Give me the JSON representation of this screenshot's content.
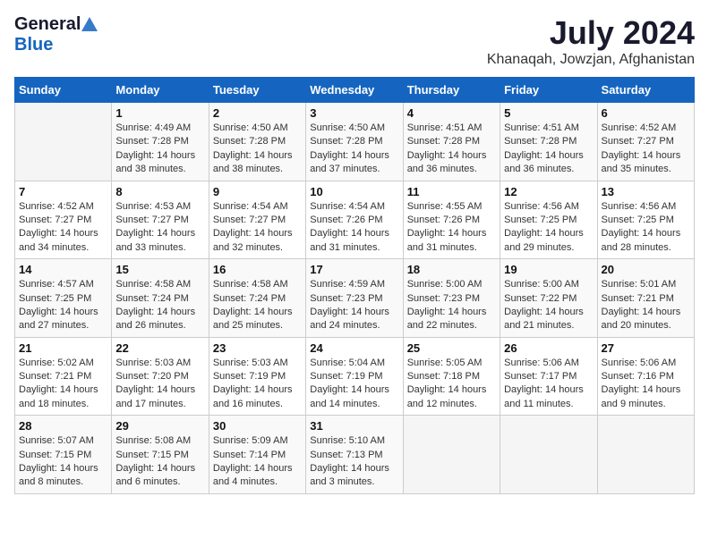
{
  "header": {
    "logo_general": "General",
    "logo_blue": "Blue",
    "title": "July 2024",
    "location": "Khanaqah, Jowzjan, Afghanistan"
  },
  "calendar": {
    "days_of_week": [
      "Sunday",
      "Monday",
      "Tuesday",
      "Wednesday",
      "Thursday",
      "Friday",
      "Saturday"
    ],
    "weeks": [
      [
        {
          "day": "",
          "sunrise": "",
          "sunset": "",
          "daylight": ""
        },
        {
          "day": "1",
          "sunrise": "Sunrise: 4:49 AM",
          "sunset": "Sunset: 7:28 PM",
          "daylight": "Daylight: 14 hours and 38 minutes."
        },
        {
          "day": "2",
          "sunrise": "Sunrise: 4:50 AM",
          "sunset": "Sunset: 7:28 PM",
          "daylight": "Daylight: 14 hours and 38 minutes."
        },
        {
          "day": "3",
          "sunrise": "Sunrise: 4:50 AM",
          "sunset": "Sunset: 7:28 PM",
          "daylight": "Daylight: 14 hours and 37 minutes."
        },
        {
          "day": "4",
          "sunrise": "Sunrise: 4:51 AM",
          "sunset": "Sunset: 7:28 PM",
          "daylight": "Daylight: 14 hours and 36 minutes."
        },
        {
          "day": "5",
          "sunrise": "Sunrise: 4:51 AM",
          "sunset": "Sunset: 7:28 PM",
          "daylight": "Daylight: 14 hours and 36 minutes."
        },
        {
          "day": "6",
          "sunrise": "Sunrise: 4:52 AM",
          "sunset": "Sunset: 7:27 PM",
          "daylight": "Daylight: 14 hours and 35 minutes."
        }
      ],
      [
        {
          "day": "7",
          "sunrise": "Sunrise: 4:52 AM",
          "sunset": "Sunset: 7:27 PM",
          "daylight": "Daylight: 14 hours and 34 minutes."
        },
        {
          "day": "8",
          "sunrise": "Sunrise: 4:53 AM",
          "sunset": "Sunset: 7:27 PM",
          "daylight": "Daylight: 14 hours and 33 minutes."
        },
        {
          "day": "9",
          "sunrise": "Sunrise: 4:54 AM",
          "sunset": "Sunset: 7:27 PM",
          "daylight": "Daylight: 14 hours and 32 minutes."
        },
        {
          "day": "10",
          "sunrise": "Sunrise: 4:54 AM",
          "sunset": "Sunset: 7:26 PM",
          "daylight": "Daylight: 14 hours and 31 minutes."
        },
        {
          "day": "11",
          "sunrise": "Sunrise: 4:55 AM",
          "sunset": "Sunset: 7:26 PM",
          "daylight": "Daylight: 14 hours and 31 minutes."
        },
        {
          "day": "12",
          "sunrise": "Sunrise: 4:56 AM",
          "sunset": "Sunset: 7:25 PM",
          "daylight": "Daylight: 14 hours and 29 minutes."
        },
        {
          "day": "13",
          "sunrise": "Sunrise: 4:56 AM",
          "sunset": "Sunset: 7:25 PM",
          "daylight": "Daylight: 14 hours and 28 minutes."
        }
      ],
      [
        {
          "day": "14",
          "sunrise": "Sunrise: 4:57 AM",
          "sunset": "Sunset: 7:25 PM",
          "daylight": "Daylight: 14 hours and 27 minutes."
        },
        {
          "day": "15",
          "sunrise": "Sunrise: 4:58 AM",
          "sunset": "Sunset: 7:24 PM",
          "daylight": "Daylight: 14 hours and 26 minutes."
        },
        {
          "day": "16",
          "sunrise": "Sunrise: 4:58 AM",
          "sunset": "Sunset: 7:24 PM",
          "daylight": "Daylight: 14 hours and 25 minutes."
        },
        {
          "day": "17",
          "sunrise": "Sunrise: 4:59 AM",
          "sunset": "Sunset: 7:23 PM",
          "daylight": "Daylight: 14 hours and 24 minutes."
        },
        {
          "day": "18",
          "sunrise": "Sunrise: 5:00 AM",
          "sunset": "Sunset: 7:23 PM",
          "daylight": "Daylight: 14 hours and 22 minutes."
        },
        {
          "day": "19",
          "sunrise": "Sunrise: 5:00 AM",
          "sunset": "Sunset: 7:22 PM",
          "daylight": "Daylight: 14 hours and 21 minutes."
        },
        {
          "day": "20",
          "sunrise": "Sunrise: 5:01 AM",
          "sunset": "Sunset: 7:21 PM",
          "daylight": "Daylight: 14 hours and 20 minutes."
        }
      ],
      [
        {
          "day": "21",
          "sunrise": "Sunrise: 5:02 AM",
          "sunset": "Sunset: 7:21 PM",
          "daylight": "Daylight: 14 hours and 18 minutes."
        },
        {
          "day": "22",
          "sunrise": "Sunrise: 5:03 AM",
          "sunset": "Sunset: 7:20 PM",
          "daylight": "Daylight: 14 hours and 17 minutes."
        },
        {
          "day": "23",
          "sunrise": "Sunrise: 5:03 AM",
          "sunset": "Sunset: 7:19 PM",
          "daylight": "Daylight: 14 hours and 16 minutes."
        },
        {
          "day": "24",
          "sunrise": "Sunrise: 5:04 AM",
          "sunset": "Sunset: 7:19 PM",
          "daylight": "Daylight: 14 hours and 14 minutes."
        },
        {
          "day": "25",
          "sunrise": "Sunrise: 5:05 AM",
          "sunset": "Sunset: 7:18 PM",
          "daylight": "Daylight: 14 hours and 12 minutes."
        },
        {
          "day": "26",
          "sunrise": "Sunrise: 5:06 AM",
          "sunset": "Sunset: 7:17 PM",
          "daylight": "Daylight: 14 hours and 11 minutes."
        },
        {
          "day": "27",
          "sunrise": "Sunrise: 5:06 AM",
          "sunset": "Sunset: 7:16 PM",
          "daylight": "Daylight: 14 hours and 9 minutes."
        }
      ],
      [
        {
          "day": "28",
          "sunrise": "Sunrise: 5:07 AM",
          "sunset": "Sunset: 7:15 PM",
          "daylight": "Daylight: 14 hours and 8 minutes."
        },
        {
          "day": "29",
          "sunrise": "Sunrise: 5:08 AM",
          "sunset": "Sunset: 7:15 PM",
          "daylight": "Daylight: 14 hours and 6 minutes."
        },
        {
          "day": "30",
          "sunrise": "Sunrise: 5:09 AM",
          "sunset": "Sunset: 7:14 PM",
          "daylight": "Daylight: 14 hours and 4 minutes."
        },
        {
          "day": "31",
          "sunrise": "Sunrise: 5:10 AM",
          "sunset": "Sunset: 7:13 PM",
          "daylight": "Daylight: 14 hours and 3 minutes."
        },
        {
          "day": "",
          "sunrise": "",
          "sunset": "",
          "daylight": ""
        },
        {
          "day": "",
          "sunrise": "",
          "sunset": "",
          "daylight": ""
        },
        {
          "day": "",
          "sunrise": "",
          "sunset": "",
          "daylight": ""
        }
      ]
    ]
  }
}
